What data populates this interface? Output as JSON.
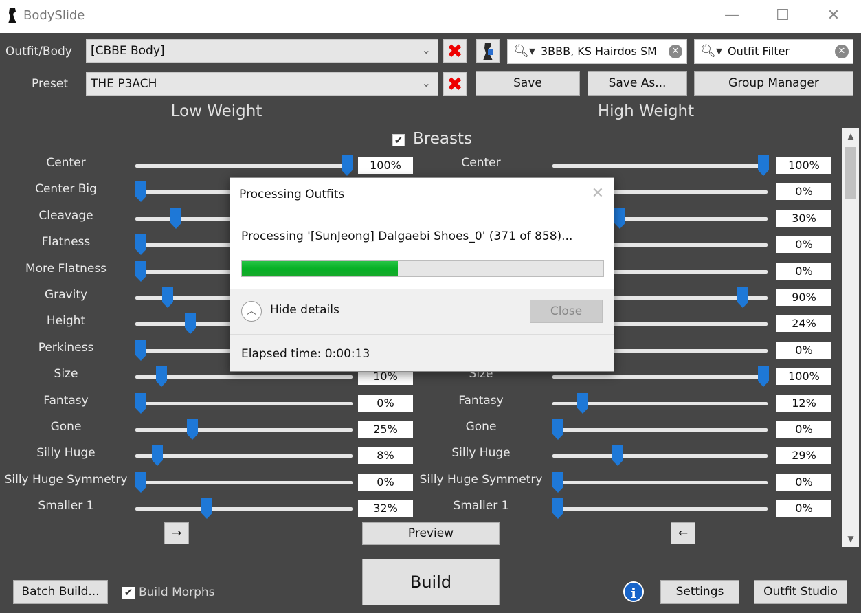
{
  "window": {
    "title": "BodySlide",
    "minimize": "—",
    "maximize": "☐",
    "close": "✕"
  },
  "toolbar": {
    "outfit_label": "Outfit/Body",
    "outfit_value": "[CBBE Body]",
    "preset_label": "Preset",
    "preset_value": "THE P3ACH",
    "group_filter": "3BBB, KS Hairdos SM",
    "outfit_filter_placeholder": "Outfit Filter",
    "save": "Save",
    "save_as": "Save As...",
    "group_manager": "Group Manager",
    "delete_glyph": "✖"
  },
  "headers": {
    "low": "Low Weight",
    "high": "High Weight",
    "category": "Breasts",
    "category_checked": true
  },
  "sliders": [
    {
      "name": "Center",
      "low": "100%",
      "high": "100%",
      "low_frac": 1.0,
      "high_frac": 1.0
    },
    {
      "name": "Center Big",
      "low": "0%",
      "high": "0%",
      "low_frac": 0.0,
      "high_frac": 0.0
    },
    {
      "name": "Cleavage",
      "low": "17%",
      "high": "30%",
      "low_frac": 0.17,
      "high_frac": 0.3
    },
    {
      "name": "Flatness",
      "low": "0%",
      "high": "0%",
      "low_frac": 0.0,
      "high_frac": 0.0
    },
    {
      "name": "More Flatness",
      "low": "0%",
      "high": "0%",
      "low_frac": 0.0,
      "high_frac": 0.0
    },
    {
      "name": "Gravity",
      "low": "13%",
      "high": "90%",
      "low_frac": 0.13,
      "high_frac": 0.9
    },
    {
      "name": "Height",
      "low": "24%",
      "high": "24%",
      "low_frac": 0.24,
      "high_frac": 0.24
    },
    {
      "name": "Perkiness",
      "low": "0%",
      "high": "0%",
      "low_frac": 0.0,
      "high_frac": 0.0
    },
    {
      "name": "Size",
      "low": "10%",
      "high": "100%",
      "low_frac": 0.1,
      "high_frac": 1.0
    },
    {
      "name": "Fantasy",
      "low": "0%",
      "high": "12%",
      "low_frac": 0.0,
      "high_frac": 0.12
    },
    {
      "name": "Gone",
      "low": "25%",
      "high": "0%",
      "low_frac": 0.25,
      "high_frac": 0.0
    },
    {
      "name": "Silly Huge",
      "low": "8%",
      "high": "29%",
      "low_frac": 0.08,
      "high_frac": 0.29
    },
    {
      "name": "Silly Huge Symmetry",
      "low": "0%",
      "high": "0%",
      "low_frac": 0.0,
      "high_frac": 0.0
    },
    {
      "name": "Smaller 1",
      "low": "32%",
      "high": "0%",
      "low_frac": 0.32,
      "high_frac": 0.0
    }
  ],
  "bottom": {
    "copy_low_to_high": "→",
    "copy_high_to_low": "←",
    "preview": "Preview",
    "build": "Build",
    "batch_build": "Batch Build...",
    "build_morphs": "Build Morphs",
    "build_morphs_checked": true,
    "info": "i",
    "settings": "Settings",
    "outfit_studio": "Outfit Studio"
  },
  "dialog": {
    "title": "Processing Outfits",
    "message": "Processing '[SunJeong] Dalgaebi Shoes_0' (371 of 858)...",
    "progress": 0.432,
    "hide_details": "Hide details",
    "close": "Close",
    "elapsed": "Elapsed time: 0:00:13"
  },
  "colors": {
    "panel_bg": "#464646",
    "thumb": "#1e78d7",
    "progress": "#06b025"
  }
}
